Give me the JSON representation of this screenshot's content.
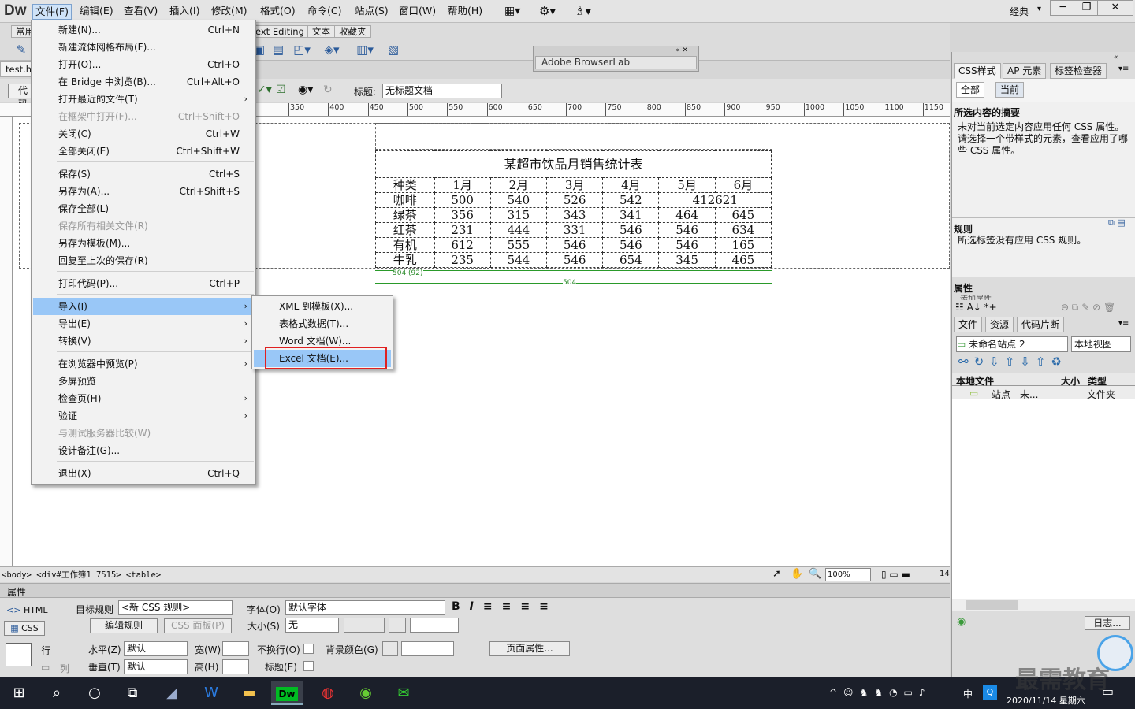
{
  "app": {
    "logo": "Dw",
    "workspace": "经典"
  },
  "menubar": [
    "文件(F)",
    "编辑(E)",
    "查看(V)",
    "插入(I)",
    "修改(M)",
    "格式(O)",
    "命令(C)",
    "站点(S)",
    "窗口(W)",
    "帮助(H)"
  ],
  "insert_tabs": [
    "常用",
    "ext Editing",
    "文本",
    "收藏夹"
  ],
  "doc": {
    "file_tab": "test.ht",
    "view_btn": "代码",
    "title_label": "标题:",
    "title_value": "无标题文档"
  },
  "ruler_ticks": [
    "350",
    "400",
    "450",
    "500",
    "550",
    "600",
    "650",
    "700",
    "750",
    "800",
    "850",
    "900",
    "950",
    "1000",
    "1050",
    "1100",
    "1150"
  ],
  "table": {
    "caption": "某超市饮品月销售统计表",
    "header": [
      "种类",
      "1月",
      "2月",
      "3月",
      "4月",
      "5月",
      "6月"
    ],
    "rows": [
      [
        "咖啡",
        "500",
        "540",
        "526",
        "542",
        "412621"
      ],
      [
        "绿茶",
        "356",
        "315",
        "343",
        "341",
        "464",
        "645"
      ],
      [
        "红茶",
        "231",
        "444",
        "331",
        "546",
        "546",
        "634"
      ],
      [
        "有机",
        "612",
        "555",
        "546",
        "546",
        "546",
        "165"
      ],
      [
        "牛乳",
        "235",
        "544",
        "546",
        "654",
        "345",
        "465"
      ]
    ],
    "width_label1": "504 (92)",
    "width_label2": "504"
  },
  "file_menu": [
    {
      "label": "新建(N)...",
      "shortcut": "Ctrl+N"
    },
    {
      "label": "新建流体网格布局(F)...",
      "shortcut": ""
    },
    {
      "label": "打开(O)...",
      "shortcut": "Ctrl+O"
    },
    {
      "label": "在 Bridge 中浏览(B)...",
      "shortcut": "Ctrl+Alt+O"
    },
    {
      "label": "打开最近的文件(T)",
      "shortcut": ""
    },
    {
      "label": "在框架中打开(F)...",
      "shortcut": "Ctrl+Shift+O"
    },
    {
      "label": "关闭(C)",
      "shortcut": "Ctrl+W"
    },
    {
      "label": "全部关闭(E)",
      "shortcut": "Ctrl+Shift+W"
    },
    {
      "label": "保存(S)",
      "shortcut": "Ctrl+S"
    },
    {
      "label": "另存为(A)...",
      "shortcut": "Ctrl+Shift+S"
    },
    {
      "label": "保存全部(L)",
      "shortcut": ""
    },
    {
      "label": "保存所有相关文件(R)",
      "shortcut": ""
    },
    {
      "label": "另存为模板(M)...",
      "shortcut": ""
    },
    {
      "label": "回复至上次的保存(R)",
      "shortcut": ""
    },
    {
      "label": "打印代码(P)...",
      "shortcut": "Ctrl+P"
    },
    {
      "label": "导入(I)",
      "shortcut": ""
    },
    {
      "label": "导出(E)",
      "shortcut": ""
    },
    {
      "label": "转换(V)",
      "shortcut": ""
    },
    {
      "label": "在浏览器中预览(P)",
      "shortcut": ""
    },
    {
      "label": "多屏预览",
      "shortcut": ""
    },
    {
      "label": "检查页(H)",
      "shortcut": ""
    },
    {
      "label": "验证",
      "shortcut": ""
    },
    {
      "label": "与测试服务器比较(W)",
      "shortcut": ""
    },
    {
      "label": "设计备注(G)...",
      "shortcut": ""
    },
    {
      "label": "退出(X)",
      "shortcut": "Ctrl+Q"
    }
  ],
  "import_menu": [
    "XML 到模板(X)...",
    "表格式数据(T)...",
    "Word 文档(W)...",
    "Excel 文档(E)..."
  ],
  "browserlab": {
    "title": "Adobe BrowserLab"
  },
  "right_panel": {
    "tabs": [
      "CSS样式",
      "AP 元素",
      "标签检查器"
    ],
    "mode": [
      "全部",
      "当前"
    ],
    "summary_head": "所选内容的摘要",
    "summary_text": "未对当前选定内容应用任何 CSS 属性。请选择一个带样式的元素，查看应用了哪些 CSS 属性。",
    "rules_head": "规则",
    "rules_text": "所选标签没有应用 CSS 规则。",
    "props_head": "属性",
    "props_add": "添加属性",
    "files_tabs": [
      "文件",
      "资源",
      "代码片断"
    ],
    "site": "未命名站点 2",
    "view": "本地视图",
    "cols": [
      "本地文件",
      "大小",
      "类型"
    ],
    "row": {
      "name": "站点 - 未...",
      "type": "文件夹"
    },
    "log": "日志..."
  },
  "status": {
    "tags": "<body> <div#工作簿1 7515> <table>",
    "zoom": "100%",
    "size": "14"
  },
  "properties": {
    "title": "属性",
    "html": "HTML",
    "css": "CSS",
    "target_label": "目标规则",
    "target_value": "<新 CSS 规则>",
    "edit_rule": "编辑规则",
    "css_panel": "CSS 面板(P)",
    "font_label": "字体(O)",
    "font_value": "默认字体",
    "size_label": "大小(S)",
    "size_value": "无",
    "row_label": "行",
    "col_label": "列",
    "horz_label": "水平(Z)",
    "horz_value": "默认",
    "vert_label": "垂直(T)",
    "vert_value": "默认",
    "w_label": "宽(W)",
    "h_label": "高(H)",
    "nowrap_label": "不换行(O)",
    "header_label": "标题(E)",
    "bg_label": "背景颜色(G)",
    "page_props": "页面属性..."
  },
  "taskbar": {
    "ime": "中",
    "time": "2020/11/14 星期六",
    "watermark": "最需教育"
  }
}
